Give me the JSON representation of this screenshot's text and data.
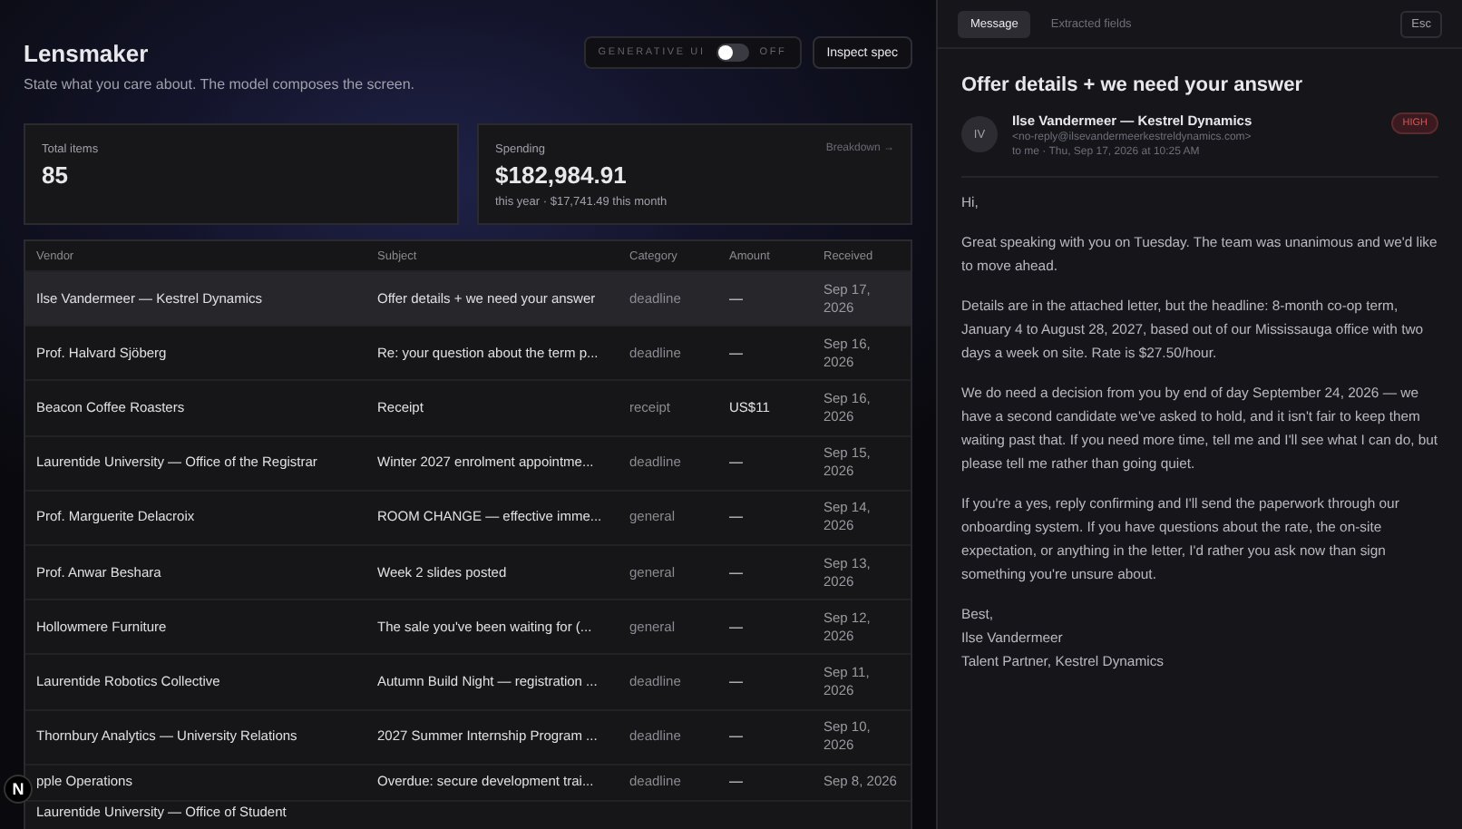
{
  "app": {
    "title": "Lensmaker",
    "subtitle": "State what you care about. The model composes the screen.",
    "generative_ui": {
      "label": "GENERATIVE UI",
      "state_label": "OFF",
      "on": false
    },
    "inspect_button": "Inspect spec"
  },
  "stats": [
    {
      "kind": "plain",
      "label": "Total items",
      "value": "85"
    },
    {
      "kind": "spending",
      "label": "Spending",
      "value": "$182,984.91",
      "detail": "this year · $17,741.49 this month",
      "link": "Breakdown →"
    }
  ],
  "table": {
    "columns": [
      "Vendor",
      "Subject",
      "Category",
      "Amount",
      "Received"
    ],
    "rows": [
      {
        "vendor": "Ilse Vandermeer — Kestrel Dynamics",
        "subject": "Offer details + we need your answer",
        "category": "deadline",
        "amount": "—",
        "received": "Sep 17, 2026",
        "selected": true
      },
      {
        "vendor": "Prof. Halvard Sjöberg",
        "subject": "Re: your question about the term p...",
        "category": "deadline",
        "amount": "—",
        "received": "Sep 16, 2026",
        "selected": false
      },
      {
        "vendor": "Beacon Coffee Roasters",
        "subject": "Receipt",
        "category": "receipt",
        "amount": "US$11",
        "received": "Sep 16, 2026",
        "selected": false
      },
      {
        "vendor": "Laurentide University — Office of the Registrar",
        "subject": "Winter 2027 enrolment appointme...",
        "category": "deadline",
        "amount": "—",
        "received": "Sep 15, 2026",
        "selected": false
      },
      {
        "vendor": "Prof. Marguerite Delacroix",
        "subject": "ROOM CHANGE — effective imme...",
        "category": "general",
        "amount": "—",
        "received": "Sep 14, 2026",
        "selected": false
      },
      {
        "vendor": "Prof. Anwar Beshara",
        "subject": "Week 2 slides posted",
        "category": "general",
        "amount": "—",
        "received": "Sep 13, 2026",
        "selected": false
      },
      {
        "vendor": "Hollowmere Furniture",
        "subject": "The sale you've been waiting for (...",
        "category": "general",
        "amount": "—",
        "received": "Sep 12, 2026",
        "selected": false
      },
      {
        "vendor": "Laurentide Robotics Collective",
        "subject": "Autumn Build Night — registration ...",
        "category": "deadline",
        "amount": "—",
        "received": "Sep 11, 2026",
        "selected": false
      },
      {
        "vendor": "Thornbury Analytics — University Relations",
        "subject": "2027 Summer Internship Program ...",
        "category": "deadline",
        "amount": "—",
        "received": "Sep 10, 2026",
        "selected": false
      },
      {
        "vendor": "pple Operations",
        "subject": "Overdue: secure development trai...",
        "category": "deadline",
        "amount": "—",
        "received": "Sep 8, 2026",
        "selected": false
      },
      {
        "vendor": "Laurentide University — Office of Student",
        "selected": false
      }
    ]
  },
  "dev_badge": "N",
  "detail": {
    "tabs": [
      {
        "label": "Message",
        "selected": true
      },
      {
        "label": "Extracted fields",
        "selected": false
      }
    ],
    "close_button": "Esc",
    "subject": "Offer details + we need your answer",
    "sender": {
      "initials": "IV",
      "name": "Ilse Vandermeer — Kestrel Dynamics",
      "email": "<no-reply@ilsevandermeerkestreldynamics.com>",
      "meta": "to me · Thu, Sep 17, 2026 at 10:25 AM",
      "priority": "HIGH"
    },
    "body": [
      "Hi,",
      "Great speaking with you on Tuesday. The team was unanimous and we'd like to move ahead.",
      "Details are in the attached letter, but the headline: 8-month co-op term, January 4 to August 28, 2027, based out of our Mississauga office with two days a week on site. Rate is $27.50/hour.",
      "We do need a decision from you by end of day September 24, 2026 — we have a second candidate we've asked to hold, and it isn't fair to keep them waiting past that. If you need more time, tell me and I'll see what I can do, but please tell me rather than going quiet.",
      "If you're a yes, reply confirming and I'll send the paperwork through our onboarding system. If you have questions about the rate, the on-site expectation, or anything in the letter, I'd rather you ask now than sign something you're unsure about."
    ],
    "signature": [
      "Best,",
      "Ilse Vandermeer",
      "Talent Partner, Kestrel Dynamics"
    ]
  }
}
